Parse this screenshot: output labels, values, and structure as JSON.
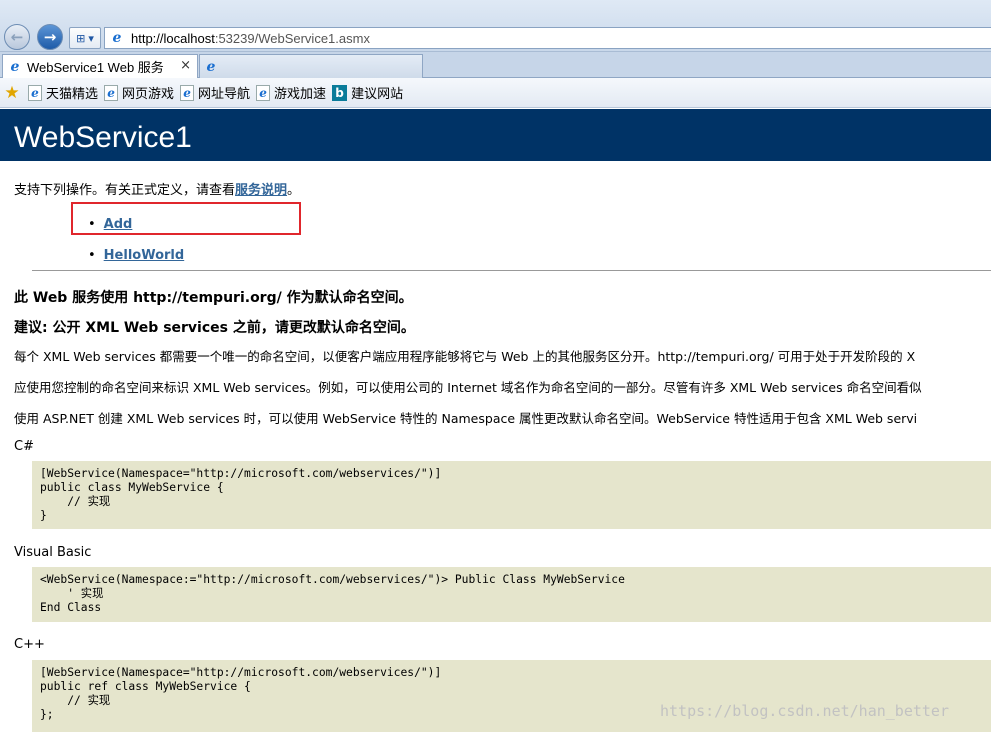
{
  "browser": {
    "url_prefix": "http://localhost",
    "url_suffix": ":53239/WebService1.asmx",
    "tab_title": "WebService1 Web 服务",
    "tab_close": "×",
    "favorites": [
      "天猫精选",
      "网页游戏",
      "网址导航",
      "游戏加速",
      "建议网站"
    ]
  },
  "page": {
    "title": "WebService1",
    "intro_text": "支持下列操作。有关正式定义，请查看",
    "intro_link": "服务说明",
    "intro_end": "。",
    "operations": [
      "Add",
      "HelloWorld"
    ],
    "namespace_heading": "此 Web 服务使用 http://tempuri.org/ 作为默认命名空间。",
    "recommendation_heading": "建议: 公开 XML Web services 之前，请更改默认命名空间。",
    "paragraphs": [
      "每个 XML Web services 都需要一个唯一的命名空间，以便客户端应用程序能够将它与 Web 上的其他服务区分开。http://tempuri.org/ 可用于处于开发阶段的 X",
      "应使用您控制的命名空间来标识 XML Web services。例如，可以使用公司的 Internet 域名作为命名空间的一部分。尽管有许多 XML Web services 命名空间看似",
      "使用 ASP.NET 创建 XML Web services 时，可以使用 WebService 特性的 Namespace 属性更改默认命名空间。WebService 特性适用于包含 XML Web servi"
    ],
    "code_samples": [
      {
        "language": "C#",
        "code": "[WebService(Namespace=\"http://microsoft.com/webservices/\")]\npublic class MyWebService {\n    // 实现\n}"
      },
      {
        "language": "Visual Basic",
        "code": "<WebService(Namespace:=\"http://microsoft.com/webservices/\")> Public Class MyWebService\n    ' 实现\nEnd Class"
      },
      {
        "language": "C++",
        "code": "[WebService(Namespace=\"http://microsoft.com/webservices/\")]\npublic ref class MyWebService {\n    // 实现\n};"
      }
    ],
    "watermark": "https://blog.csdn.net/han_better"
  },
  "colors": {
    "header_band": "#003366",
    "link": "#336699",
    "code_bg": "#e5e5cc",
    "highlight": "#e0262c"
  }
}
